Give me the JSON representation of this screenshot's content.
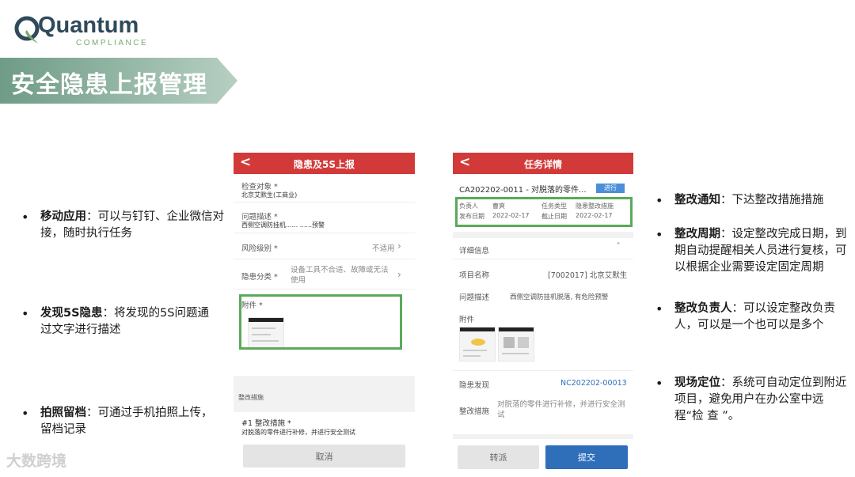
{
  "logo": {
    "name": "Quantum",
    "sub": "COMPLIANCE"
  },
  "title": "安全隐患上报管理",
  "left_bullets": [
    {
      "bold": "移动应用",
      "text": "：可以与钉钉、企业微信对接，随时执行任务"
    },
    {
      "bold": "发现5S隐患",
      "text": "：将发现的5S问题通过文字进行描述"
    },
    {
      "bold": "拍照留档",
      "text": "：可通过手机拍照上传，留档记录"
    }
  ],
  "right_bullets": [
    {
      "bold": "整改通知",
      "text": "：下达整改措施措施"
    },
    {
      "bold": "整改周期",
      "text": "：设定整改完成日期，到期自动提醒相关人员进行复核，可以根据企业需要设定固定周期"
    },
    {
      "bold": "整改负责人",
      "text": "：可以设定整改负责人，可以是一个也可以是多个"
    },
    {
      "bold": "现场定位",
      "text": "：系统可自动定位到附近项目，避免用户在办公室中远程“检 查 ”。"
    }
  ],
  "phone1": {
    "back": "<",
    "title": "隐患及5S上报",
    "fields": {
      "target_label": "检查对象 *",
      "target_value": "北京艾默生(工商业)",
      "desc_label": "问题描述 *",
      "desc_value": "西侧空调防挂机...... ......预警",
      "risk_label": "风险级别 *",
      "risk_value": "不适用",
      "category_label": "隐患分类 *",
      "category_value": "设备工具不合适、故障或无法使用",
      "attach_label": "附件 *",
      "section_label": "整改措施",
      "measure_label": "#1 整改措施 *",
      "measure_value": "对脱落的零件进行补修，并进行安全测试"
    },
    "cancel": "取消"
  },
  "phone2": {
    "back": "<",
    "title": "任务详情",
    "task_id": "CA202202-0011 - 对脱落的零件...",
    "status": "进行",
    "info": {
      "owner_label": "负责人",
      "owner_value": "曹爽",
      "type_label": "任务类型",
      "type_value": "隐患整改措施",
      "publish_label": "发布日期",
      "publish_value": "2022-02-17",
      "due_label": "截止日期",
      "due_value": "2022-02-17"
    },
    "detail_label": "详细信息",
    "project_label": "项目名称",
    "project_value": "[7002017] 北京艾默生",
    "desc_label": "问题描述",
    "desc_value": "西侧空调防挂机脱落, 有危险预警",
    "attach_label": "附件",
    "found_label": "隐患发现",
    "found_value": "NC202202-00013",
    "measure_label": "整改措施",
    "measure_value": "对脱落的零件进行补修，并进行安全测试",
    "transfer": "转派",
    "submit": "提交"
  },
  "watermark": "大数跨境",
  "colors": {
    "brand_red": "#d23a3a",
    "banner_green": "#7fa890",
    "highlight_green": "#5aaa5a",
    "submit_blue": "#2f6fba"
  }
}
